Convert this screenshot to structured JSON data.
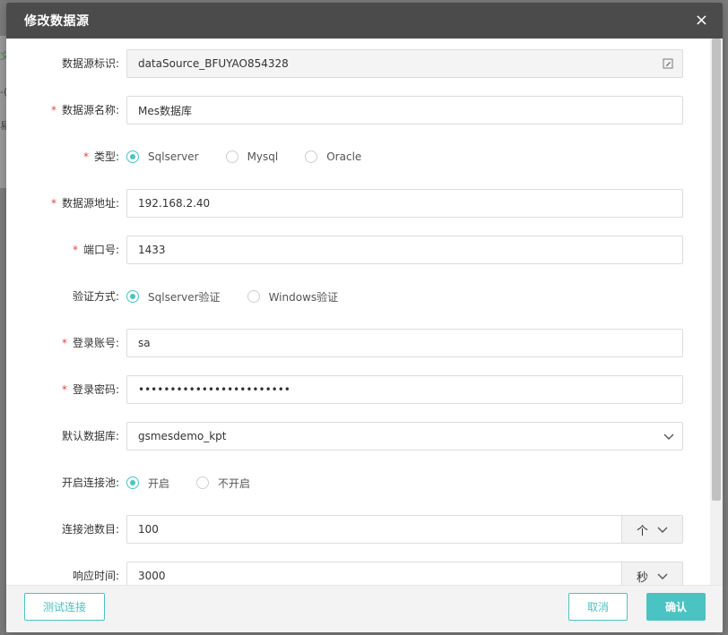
{
  "background": {
    "fragments": [
      "文",
      "-(",
      "易"
    ]
  },
  "modal": {
    "title": "修改数据源",
    "close_label": "×"
  },
  "form": {
    "datasource_id": {
      "label": "数据源标识:",
      "value": "dataSource_BFUYAO854328",
      "required": false
    },
    "datasource_name": {
      "label": "数据源名称:",
      "value": "Mes数据库",
      "required": true
    },
    "type": {
      "label": "类型:",
      "required": true,
      "options": [
        "Sqlserver",
        "Mysql",
        "Oracle"
      ],
      "selected": "Sqlserver"
    },
    "address": {
      "label": "数据源地址:",
      "value": "192.168.2.40",
      "required": true
    },
    "port": {
      "label": "端口号:",
      "value": "1433",
      "required": true
    },
    "auth": {
      "label": "验证方式:",
      "required": false,
      "options": [
        "Sqlserver验证",
        "Windows验证"
      ],
      "selected": "Sqlserver验证"
    },
    "login_account": {
      "label": "登录账号:",
      "value": "sa",
      "required": true
    },
    "login_password": {
      "label": "登录密码:",
      "value": "••••••••••••••••••••••••",
      "required": true
    },
    "default_db": {
      "label": "默认数据库:",
      "value": "gsmesdemo_kpt",
      "required": false
    },
    "pool": {
      "label": "开启连接池:",
      "required": false,
      "options": [
        "开启",
        "不开启"
      ],
      "selected": "开启"
    },
    "pool_size": {
      "label": "连接池数目:",
      "value": "100",
      "unit": "个",
      "required": false
    },
    "response_time": {
      "label": "响应时间:",
      "value": "3000",
      "unit": "秒",
      "required": false
    }
  },
  "footer": {
    "test_button": "测试连接",
    "cancel_button": "取消",
    "confirm_button": "确认"
  },
  "colors": {
    "accent": "#4cc3c3",
    "header_bg": "#4b4b4b",
    "required": "#e64545"
  },
  "icons": {
    "edit": "edit-icon",
    "dropdown": "chevron-down-icon",
    "close": "close-icon"
  }
}
